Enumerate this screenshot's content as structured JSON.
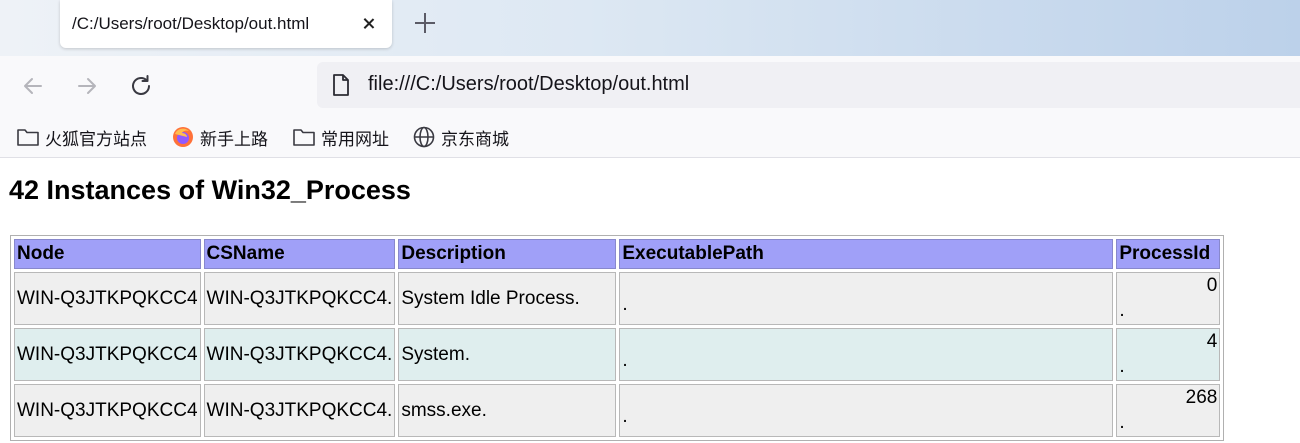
{
  "tab": {
    "title": "/C:/Users/root/Desktop/out.html"
  },
  "nav": {
    "url": "file:///C:/Users/root/Desktop/out.html"
  },
  "bookmarks": [
    {
      "label": "火狐官方站点",
      "icon": "folder-icon"
    },
    {
      "label": "新手上路",
      "icon": "firefox-icon"
    },
    {
      "label": "常用网址",
      "icon": "folder-icon"
    },
    {
      "label": "京东商城",
      "icon": "globe-icon"
    }
  ],
  "page": {
    "title": "42 Instances of Win32_Process",
    "table": {
      "headers": [
        "Node",
        "CSName",
        "Description",
        "ExecutablePath",
        "ProcessId"
      ],
      "rows": [
        [
          "WIN-Q3JTKPQKCC4",
          "WIN-Q3JTKPQKCC4.",
          "System Idle Process.",
          ".",
          "0",
          "."
        ],
        [
          "WIN-Q3JTKPQKCC4",
          "WIN-Q3JTKPQKCC4.",
          "System.",
          ".",
          "4",
          "."
        ],
        [
          "WIN-Q3JTKPQKCC4",
          "WIN-Q3JTKPQKCC4.",
          "smss.exe.",
          ".",
          "268",
          "."
        ]
      ]
    }
  },
  "colors": {
    "header_bg": "#a0a0f8",
    "row_odd": "#efefef",
    "row_even": "#dfeeee"
  }
}
